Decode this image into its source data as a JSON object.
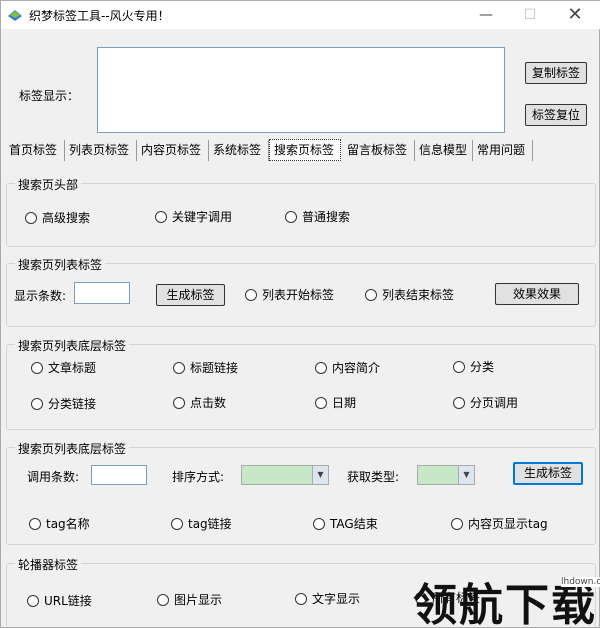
{
  "window": {
    "title": "织梦标签工具--风火专用！",
    "min": "—",
    "max": "☐",
    "close": "✕"
  },
  "display": {
    "label": "标签显示：",
    "copy_button": "复制标签",
    "reset_button": "标签复位"
  },
  "tabs": [
    "首页标签",
    "列表页标签",
    "内容页标签",
    "系统标签",
    "搜索页标签",
    "留言板标签",
    "信息模型",
    "常用问题"
  ],
  "search_header": {
    "title": "搜索页头部",
    "options": [
      "高级搜索",
      "关键字调用",
      "普通搜索"
    ]
  },
  "search_list": {
    "title": "搜索页列表标签",
    "count_label": "显示条数:",
    "generate_button": "生成标签",
    "options": [
      "列表开始标签",
      "列表结束标签"
    ],
    "effect_button": "效果效果"
  },
  "search_bottom": {
    "title": "搜索页列表底层标签",
    "options": [
      "文章标题",
      "标题链接",
      "内容简介",
      "分类",
      "分类链接",
      "点击数",
      "日期",
      "分页调用"
    ]
  },
  "search_bottom2": {
    "title": "搜索页列表底层标签",
    "count_label": "调用条数:",
    "sort_label": "排序方式:",
    "type_label": "获取类型:",
    "generate_button": "生成标签",
    "options": [
      "tag名称",
      "tag链接",
      "TAG结束",
      "内容页显示tag"
    ]
  },
  "carousel": {
    "title": "轮播器标签",
    "options": [
      "URL链接",
      "图片显示",
      "文字显示",
      "所有标签"
    ]
  },
  "watermark": {
    "text": "领航下载",
    "url": "lhdown.com"
  }
}
